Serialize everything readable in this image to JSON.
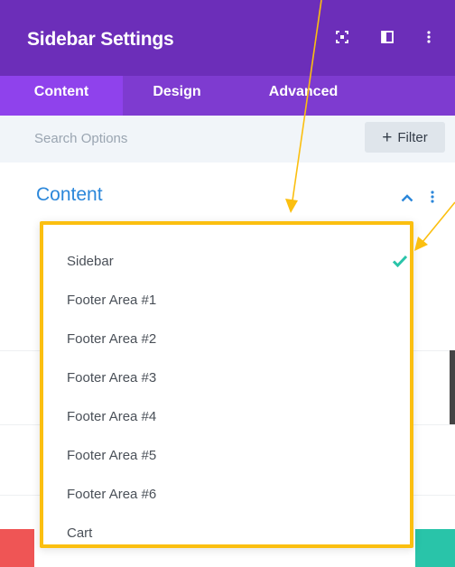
{
  "header": {
    "title": "Sidebar Settings",
    "icons": [
      "expand-icon",
      "split-view-icon",
      "more-vertical-icon"
    ],
    "background": "#6c2eb9"
  },
  "tabs": [
    {
      "label": "Content",
      "active": true
    },
    {
      "label": "Design",
      "active": false
    },
    {
      "label": "Advanced",
      "active": false
    }
  ],
  "search": {
    "placeholder": "Search Options",
    "value": ""
  },
  "filter": {
    "label": "Filter",
    "icon": "plus-icon"
  },
  "section": {
    "title": "Content",
    "color": "#2b87da"
  },
  "dropdown": {
    "selected": "Sidebar",
    "highlight_color": "#fbbf10",
    "check_color": "#29c4a9",
    "items": [
      {
        "label": "Sidebar",
        "selected": true
      },
      {
        "label": "Footer Area #1",
        "selected": false
      },
      {
        "label": "Footer Area #2",
        "selected": false
      },
      {
        "label": "Footer Area #3",
        "selected": false
      },
      {
        "label": "Footer Area #4",
        "selected": false
      },
      {
        "label": "Footer Area #5",
        "selected": false
      },
      {
        "label": "Footer Area #6",
        "selected": false
      },
      {
        "label": "Cart",
        "selected": false
      }
    ]
  },
  "footer": {
    "cancel_color": "#ef5555",
    "save_color": "#29c4a9"
  }
}
